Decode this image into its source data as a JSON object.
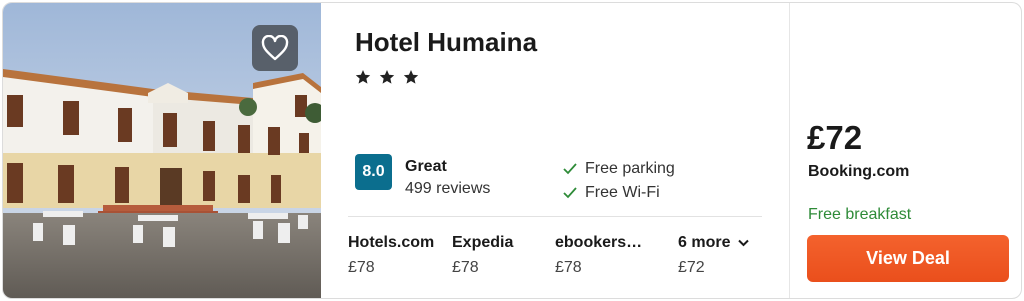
{
  "hotel": {
    "name": "Hotel Humaina",
    "star_count": 3,
    "rating": {
      "score": "8.0",
      "label": "Great",
      "reviews": "499 reviews",
      "color": "#0b6e8e"
    },
    "amenities": [
      "Free parking",
      "Free Wi-Fi"
    ]
  },
  "providers": [
    {
      "name": "Hotels.com",
      "price": "£78"
    },
    {
      "name": "Expedia",
      "price": "£78"
    },
    {
      "name": "ebookers…",
      "price": "£78"
    },
    {
      "name": "6 more",
      "price": "£72"
    }
  ],
  "deal": {
    "price": "£72",
    "site": "Booking.com",
    "perk": "Free breakfast",
    "button_label": "View Deal",
    "button_color": "#f25a26"
  },
  "icons": {
    "favorite": "heart-outline-icon",
    "star": "star-icon",
    "check": "check-icon",
    "more": "chevron-down-icon"
  }
}
